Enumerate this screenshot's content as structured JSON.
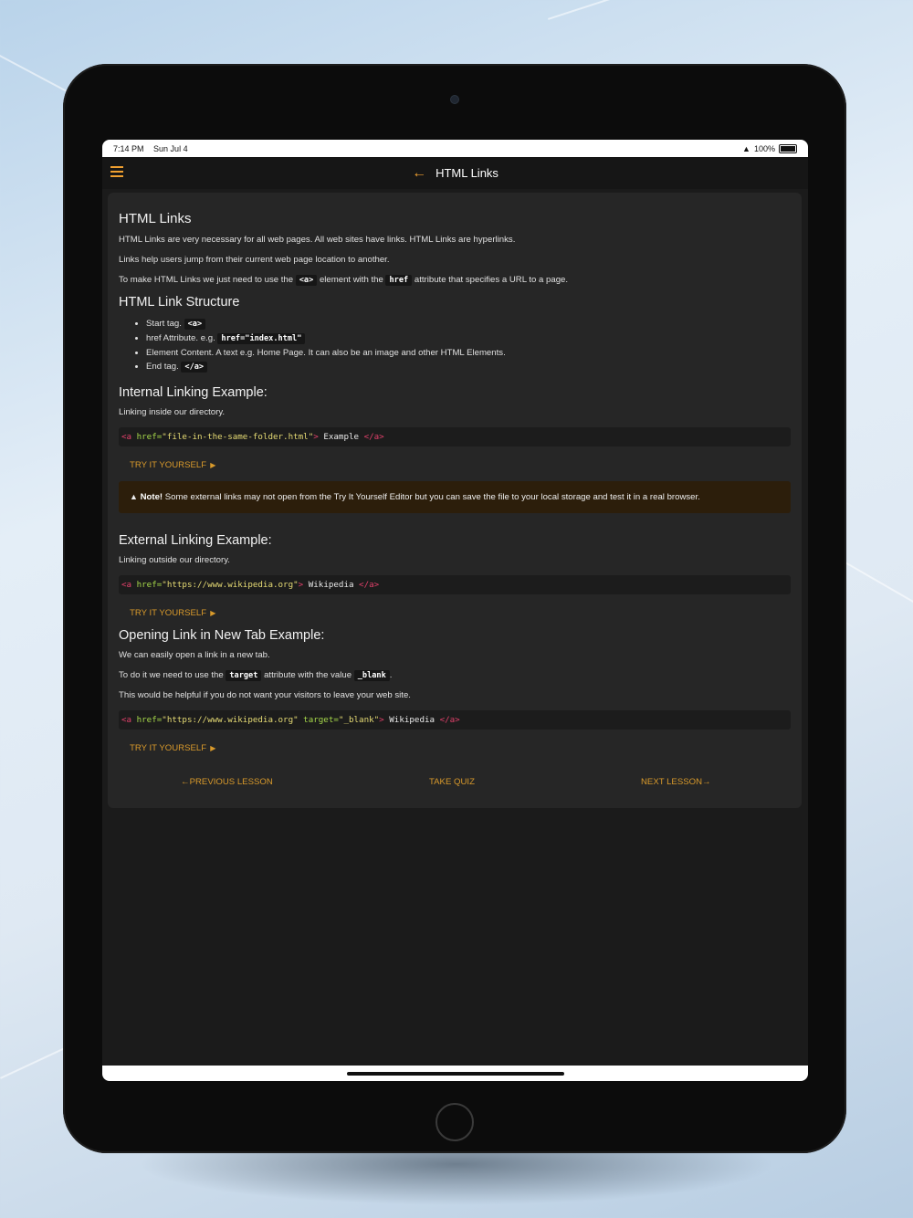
{
  "status": {
    "time": "7:14 PM",
    "date": "Sun Jul 4",
    "battery": "100%"
  },
  "nav": {
    "title": "HTML Links"
  },
  "lesson": {
    "heading": "HTML Links",
    "intro_p1": "HTML Links are very necessary for all web pages. All web sites have links. HTML Links are hyperlinks.",
    "intro_p2": "Links help users jump from their current web page location to another.",
    "intro_p3_a": "To make HTML Links we just need to use the",
    "intro_p3_code1": "<a>",
    "intro_p3_b": "element with the",
    "intro_p3_code2": "href",
    "intro_p3_c": "attribute that specifies a URL to a page.",
    "structure_heading": "HTML Link Structure",
    "structure_items": [
      {
        "text": "Start tag. ",
        "code": "<a>"
      },
      {
        "text": "href Attribute. e.g. ",
        "code": "href=\"index.html\""
      },
      {
        "text": "Element Content. A text e.g. Home Page. It can also be an image and other HTML Elements.",
        "code": ""
      },
      {
        "text": "End tag. ",
        "code": "</a>"
      }
    ],
    "internal_heading": "Internal Linking Example:",
    "internal_desc": "Linking inside our directory.",
    "internal_code": {
      "open": "<a",
      "attr": " href=",
      "val": "\"file-in-the-same-folder.html\"",
      "close_open": ">",
      "text": " Example ",
      "end": "</a>"
    },
    "try_label": "TRY IT YOURSELF",
    "note_label": "Note!",
    "note_text": " Some external links may not open from the Try It Yourself Editor but you can save the file to your local storage and test it in a real browser.",
    "external_heading": "External Linking Example:",
    "external_desc": "Linking outside our directory.",
    "external_code": {
      "open": "<a",
      "attr": " href=",
      "val": "\"https://www.wikipedia.org\"",
      "close_open": ">",
      "text": " Wikipedia ",
      "end": "</a>"
    },
    "newtab_heading": "Opening Link in New Tab Example:",
    "newtab_p1": "We can easily open a link in a new tab.",
    "newtab_p2_a": "To do it we need to use the",
    "newtab_p2_code1": "target",
    "newtab_p2_b": "attribute with the value",
    "newtab_p2_code2": "_blank",
    "newtab_p2_c": ".",
    "newtab_p3": "This would be helpful if you do not want your visitors to leave your web site.",
    "newtab_code": {
      "open": "<a",
      "attr": " href=",
      "val": "\"https://www.wikipedia.org\"",
      "attr2": " target=",
      "val2": "\"_blank\"",
      "close_open": ">",
      "text": " Wikipedia ",
      "end": "</a>"
    }
  },
  "bottom_nav": {
    "prev": "←PREVIOUS LESSON",
    "quiz": "TAKE QUIZ",
    "next": "NEXT LESSON→"
  },
  "icons": {
    "menu": "hamburger-menu-icon",
    "back": "back-arrow-icon",
    "wifi": "wifi-icon",
    "battery": "battery-icon",
    "warning": "warning-icon",
    "play": "play-triangle-icon"
  },
  "colors": {
    "accent": "#f0a030",
    "tag": "#e0406a",
    "attribute": "#a6d84a",
    "string": "#e6db74",
    "note_bg": "#2c1e0b"
  }
}
